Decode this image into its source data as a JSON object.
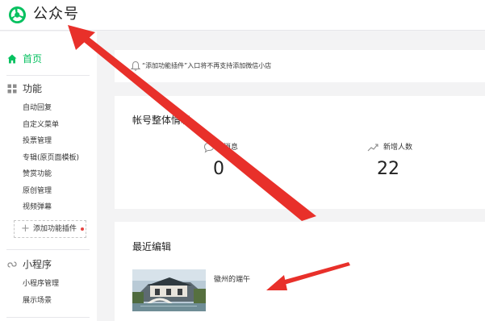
{
  "header": {
    "brand": "公众号",
    "logo_icon": "wechat-official-account-logo"
  },
  "sidebar": {
    "home": {
      "label": "首页",
      "icon": "home-icon",
      "active_color": "#07c160"
    },
    "features": {
      "label": "功能",
      "icon": "grid-icon",
      "items": [
        {
          "label": "自动回复"
        },
        {
          "label": "自定义菜单"
        },
        {
          "label": "投票管理"
        },
        {
          "label": "专辑(原页面模板)"
        },
        {
          "label": "赞赏功能"
        },
        {
          "label": "原创管理"
        },
        {
          "label": "视频弹幕"
        }
      ],
      "add_plugin": "添加功能插件"
    },
    "miniprogram": {
      "label": "小程序",
      "icon": "mini-program-icon",
      "items": [
        {
          "label": "小程序管理"
        },
        {
          "label": "展示场景"
        }
      ]
    }
  },
  "notice": {
    "icon": "bell-icon",
    "text": "“添加功能插件”入口将不再支持添加微信小店"
  },
  "stats": {
    "title": "帐号整体情况",
    "items": [
      {
        "label": "新消息",
        "value": "0",
        "icon": "chat-bubble-icon"
      },
      {
        "label": "新增人数",
        "value": "22",
        "icon": "trend-up-icon"
      }
    ]
  },
  "recent": {
    "title": "最近编辑",
    "articles": [
      {
        "title": "徽州的端午"
      }
    ]
  },
  "colors": {
    "accent": "#07c160",
    "annotation_arrow": "#e8302a",
    "background": "#f3f3f4"
  }
}
